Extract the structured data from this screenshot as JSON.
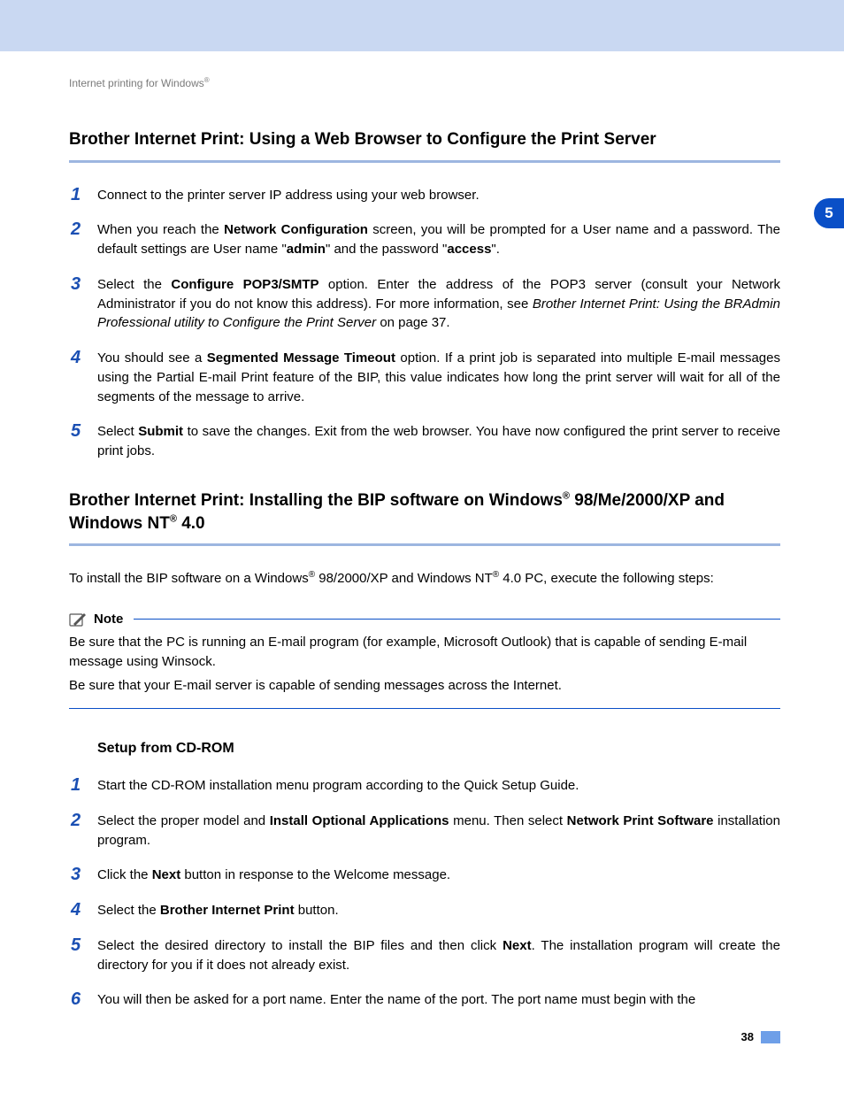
{
  "runningHeader": {
    "text": "Internet printing for Windows",
    "regMark": "®"
  },
  "sideTab": "5",
  "pageNumber": "38",
  "section1": {
    "title": "Brother Internet Print: Using a Web Browser to Configure the Print Server",
    "steps": [
      {
        "n": "1",
        "html": "Connect to the printer server IP address using your web browser."
      },
      {
        "n": "2",
        "html": "When you reach the <b>Network Configuration</b> screen, you will be prompted for a User name and a password. The default settings are User name \"<b>admin</b>\" and the password \"<b>access</b>\"."
      },
      {
        "n": "3",
        "html": "Select the <b>Configure POP3/SMTP</b> option. Enter the address of the POP3 server (consult your Network Administrator if you do not know this address). For more information, see <i>Brother Internet Print: Using the BRAdmin Professional utility to Configure the Print Server</i> on page 37."
      },
      {
        "n": "4",
        "html": "You should see a <b>Segmented Message Timeout</b> option. If a print job is separated into multiple E-mail messages using the Partial E-mail Print feature of the BIP, this value indicates how long the print server will wait for all of the segments of the message to arrive."
      },
      {
        "n": "5",
        "html": "Select <b>Submit</b> to save the changes. Exit from the web browser. You have now configured the print server to receive print jobs."
      }
    ]
  },
  "section2": {
    "titleHtml": "Brother Internet Print: Installing the BIP software on Windows<sup>®</sup> 98/Me/2000/XP and Windows NT<sup>®</sup> 4.0",
    "introHtml": "To install the BIP software on a Windows<sup>®</sup> 98/2000/XP and Windows NT<sup>®</sup> 4.0 PC, execute the following steps:",
    "note": {
      "label": "Note",
      "lines": [
        "Be sure that the PC is running an E-mail program (for example, Microsoft Outlook) that is capable of sending E-mail message using Winsock.",
        "Be sure that your E-mail server is capable of sending messages across the Internet."
      ]
    },
    "subsection": {
      "title": "Setup from CD-ROM",
      "steps": [
        {
          "n": "1",
          "html": "Start the CD-ROM installation menu program according to the Quick Setup Guide."
        },
        {
          "n": "2",
          "html": "Select the proper model and <b>Install Optional Applications</b> menu. Then select <b>Network Print Software</b> installation program."
        },
        {
          "n": "3",
          "html": "Click the <b>Next</b> button in response to the Welcome message."
        },
        {
          "n": "4",
          "html": "Select the <b>Brother Internet Print</b> button."
        },
        {
          "n": "5",
          "html": "Select the desired directory to install the BIP files and then click <b>Next</b>. The installation program will create the directory for you if it does not already exist."
        },
        {
          "n": "6",
          "html": "You will then be asked for a port name. Enter the name of the port. The port name must begin with the"
        }
      ]
    }
  }
}
